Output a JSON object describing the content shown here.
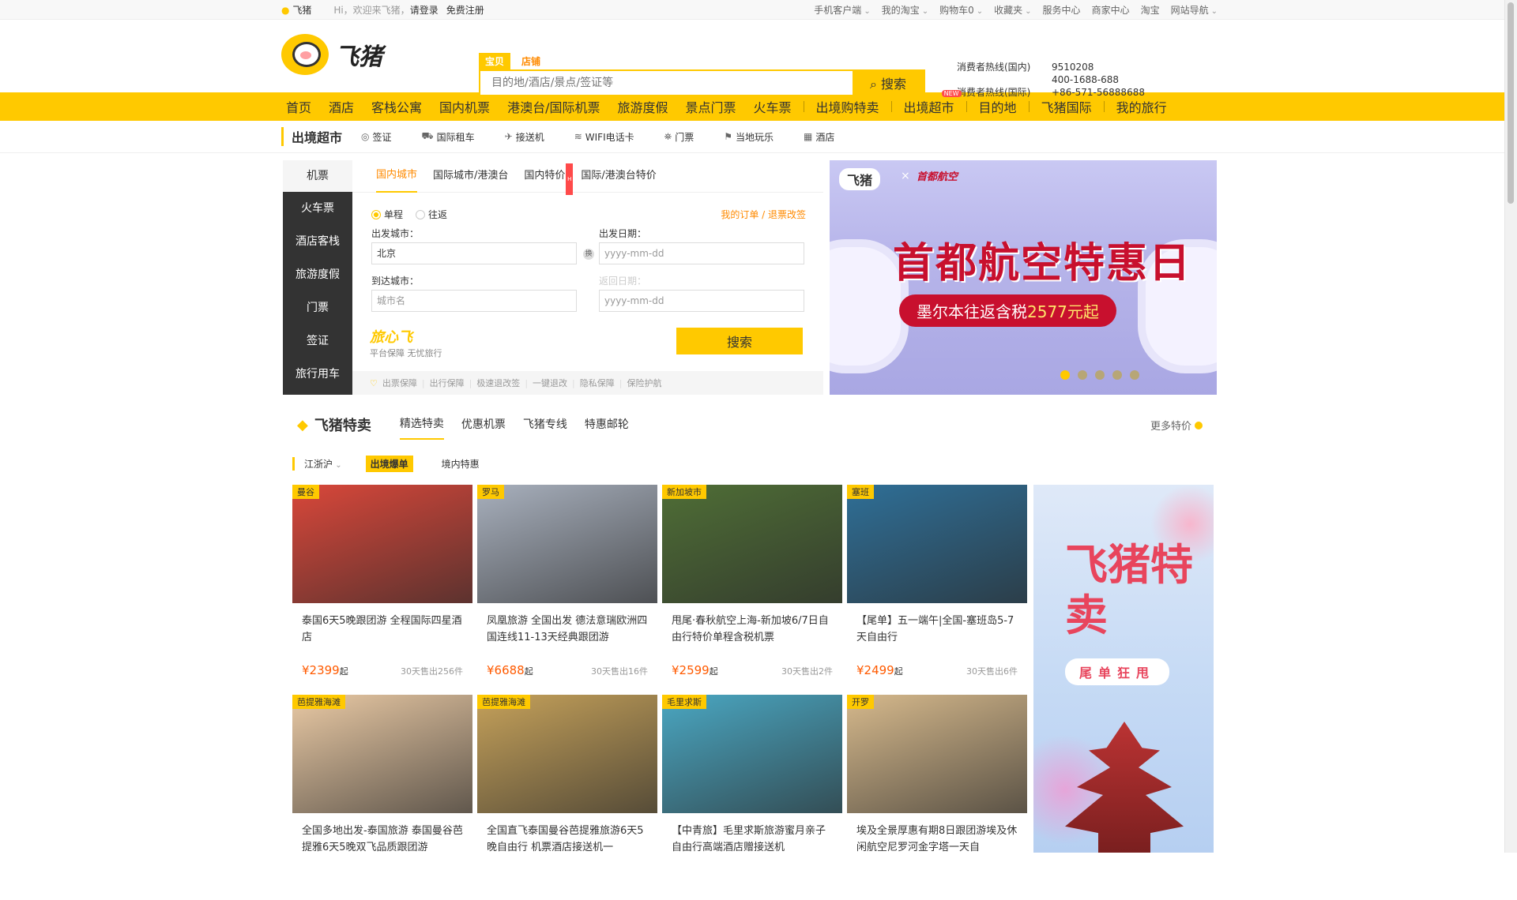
{
  "topbar": {
    "brand": "飞猪",
    "greeting": "Hi，欢迎来飞猪，",
    "login": "请登录",
    "register": "免费注册",
    "right": [
      "手机客户端",
      "我的淘宝",
      "购物车0",
      "收藏夹",
      "服务中心",
      "商家中心",
      "淘宝",
      "网站导航"
    ]
  },
  "header": {
    "logo_text": "飞猪",
    "search": {
      "tabs": [
        "宝贝",
        "店铺"
      ],
      "placeholder": "目的地/酒店/景点/签证等",
      "button": "搜索"
    },
    "hotline": [
      {
        "label": "消费者热线(国内)",
        "value": "9510208"
      },
      {
        "label": "",
        "value": "400-1688-688"
      },
      {
        "label": "消费者热线(国际)",
        "value": "+86-571-56888688"
      }
    ]
  },
  "nav": {
    "items": [
      "首页",
      "酒店",
      "客栈公寓",
      "国内机票",
      "港澳台/国际机票",
      "旅游度假",
      "景点门票",
      "火车票",
      "出境购特卖",
      "出境超市",
      "目的地",
      "飞猪国际",
      "我的旅行"
    ],
    "new_badge": "NEW"
  },
  "subnav": {
    "brand": "出境超市",
    "items": [
      "签证",
      "国际租车",
      "接送机",
      "WIFI电话卡",
      "门票",
      "当地玩乐",
      "酒店"
    ]
  },
  "booking": {
    "side": [
      "机票",
      "火车票",
      "酒店客栈",
      "旅游度假",
      "门票",
      "签证",
      "旅行用车"
    ],
    "tabs": [
      "国内城市",
      "国际城市/港澳台",
      "国内特价",
      "国际/港澳台特价"
    ],
    "hot_badge": "H",
    "trip_types": [
      "单程",
      "往返"
    ],
    "my_orders": "我的订单 / 退票改签",
    "from_label": "出发城市：",
    "from_value": "北京",
    "date_label": "出发日期：",
    "date_placeholder": "yyyy-mm-dd",
    "to_label": "到达城市：",
    "to_placeholder": "城市名",
    "return_label": "返回日期：",
    "return_placeholder": "yyyy-mm-dd",
    "swap": "换",
    "travel_brand": "旅心飞",
    "travel_slogan": "平台保障 无忧旅行",
    "search_button": "搜索",
    "guarantees": [
      "出票保障",
      "出行保障",
      "极速退改签",
      "一键退改",
      "隐私保障",
      "保险护航"
    ]
  },
  "banner": {
    "logo": "飞猪",
    "times": "×",
    "airline": "首都航空",
    "title": "首都航空特惠日",
    "subtitle_prefix": "墨尔本往返含税",
    "subtitle_price": "2577元起",
    "dots": 5,
    "active_dot": 0
  },
  "deals": {
    "title": "飞猪特卖",
    "tabs": [
      "精选特卖",
      "优惠机票",
      "飞猪专线",
      "特惠邮轮"
    ],
    "more": "更多特价",
    "region": "江浙沪",
    "filters": [
      "出境爆单",
      "境内特惠"
    ],
    "cards": [
      {
        "loc": "曼谷",
        "name": "泰国6天5晚跟团游 全程国际四星酒店",
        "price": "¥2399",
        "suffix": "起",
        "sold": "30天售出256件",
        "img_color": "#d9473a"
      },
      {
        "loc": "罗马",
        "name": "凤凰旅游 全国出发 德法意瑞欧洲四国连线11-13天经典跟团游",
        "price": "¥6688",
        "suffix": "起",
        "sold": "30天售出16件",
        "img_color": "#a8b0bd"
      },
      {
        "loc": "新加坡市",
        "name": "甩尾·春秋航空上海-新加坡6/7日自由行特价单程含税机票",
        "price": "¥2599",
        "suffix": "起",
        "sold": "30天售出2件",
        "img_color": "#4f6e36"
      },
      {
        "loc": "塞班",
        "name": "【尾单】五一端午|全国-塞班岛5-7天自由行",
        "price": "¥2499",
        "suffix": "起",
        "sold": "30天售出6件",
        "img_color": "#2f6f97"
      },
      {
        "loc": "芭提雅海滩",
        "name": "全国多地出发-泰国旅游 泰国曼谷芭提雅6天5晚双飞品质跟团游",
        "price": "",
        "suffix": "",
        "sold": "",
        "img_color": "#e9c9a4"
      },
      {
        "loc": "芭提雅海滩",
        "name": "全国直飞泰国曼谷芭提雅旅游6天5晚自由行 机票酒店接送机一",
        "price": "",
        "suffix": "",
        "sold": "",
        "img_color": "#c5a15a"
      },
      {
        "loc": "毛里求斯",
        "name": "【中青旅】毛里求斯旅游蜜月亲子自由行高端酒店赠接送机",
        "price": "",
        "suffix": "",
        "sold": "",
        "img_color": "#4aa7c2"
      },
      {
        "loc": "开罗",
        "name": "埃及全景厚惠有期8日跟团游埃及休闲航空尼罗河金字塔一天自",
        "price": "",
        "suffix": "",
        "sold": "",
        "img_color": "#d6b98c"
      }
    ],
    "side_ad": {
      "title": "飞猪特卖",
      "pill": "尾单狂甩"
    }
  }
}
